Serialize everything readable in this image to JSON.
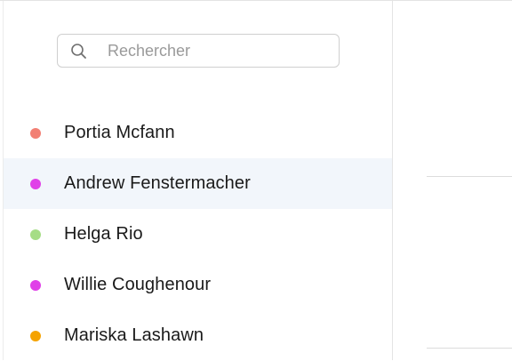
{
  "search": {
    "placeholder": "Rechercher",
    "icon": "search-icon"
  },
  "contacts": [
    {
      "name": "Portia Mcfann",
      "status_color": "#f28074",
      "selected": false
    },
    {
      "name": "Andrew Fenstermacher",
      "status_color": "#e040e8",
      "selected": true
    },
    {
      "name": "Helga Rio",
      "status_color": "#a6dd86",
      "selected": false
    },
    {
      "name": "Willie Coughenour",
      "status_color": "#e040e8",
      "selected": false
    },
    {
      "name": "Mariska Lashawn",
      "status_color": "#f5a300",
      "selected": false
    }
  ],
  "colors": {
    "selected_row_bg": "#f2f6fb",
    "border": "#e4e4e4",
    "placeholder": "#9a9a9a"
  }
}
